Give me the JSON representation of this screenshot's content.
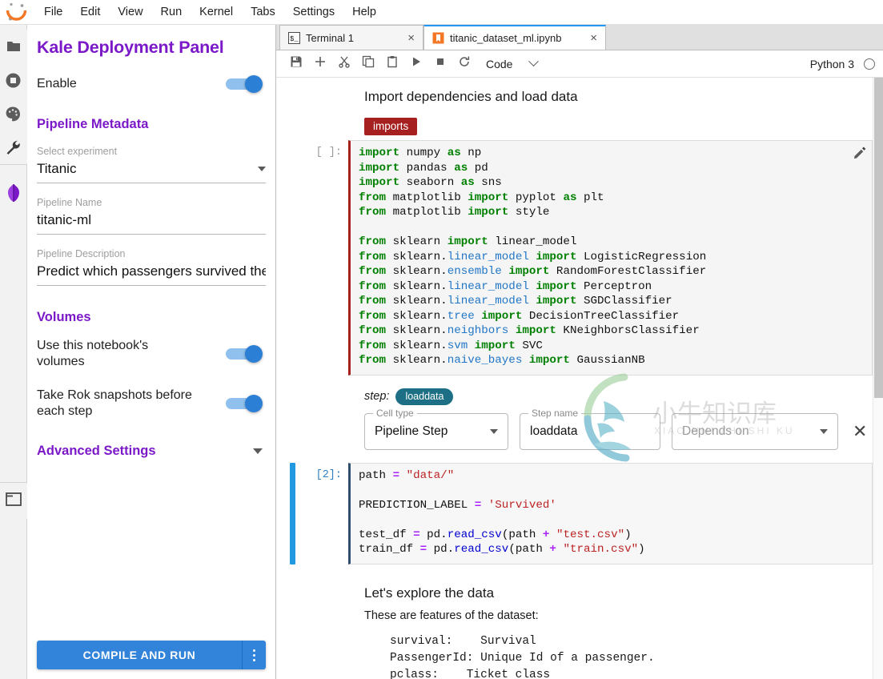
{
  "menubar": {
    "logo_icon": "jupyter-logo-icon",
    "items": [
      "File",
      "Edit",
      "View",
      "Run",
      "Kernel",
      "Tabs",
      "Settings",
      "Help"
    ]
  },
  "rail": {
    "items": [
      {
        "icon": "folder-icon",
        "name": "file-browser"
      },
      {
        "icon": "running-terminals-icon",
        "name": "running-terminals"
      },
      {
        "icon": "palette-icon",
        "name": "command-palette"
      },
      {
        "icon": "wrench-icon",
        "name": "property-inspector"
      },
      {
        "icon": "kale-logo-icon",
        "name": "kale-panel"
      },
      {
        "icon": "window-icon",
        "name": "open-tabs"
      }
    ]
  },
  "kale": {
    "title": "Kale Deployment Panel",
    "enable": {
      "label": "Enable",
      "on": true
    },
    "pipeline_metadata": {
      "section": "Pipeline Metadata",
      "experiment": {
        "label": "Select experiment",
        "value": "Titanic"
      },
      "pipeline_name": {
        "label": "Pipeline Name",
        "value": "titanic-ml"
      },
      "pipeline_description": {
        "label": "Pipeline Description",
        "value": "Predict which passengers survived the"
      }
    },
    "volumes": {
      "section": "Volumes",
      "use_notebook_volumes": {
        "label": "Use this notebook's volumes",
        "on": true
      },
      "rok_snapshots": {
        "label": "Take Rok snapshots before each step",
        "on": true
      }
    },
    "advanced_settings": {
      "label": "Advanced Settings",
      "caret": "chevron-down-icon"
    },
    "compile_and_run": {
      "label": "COMPILE AND RUN",
      "more_icon": "more-vertical-icon"
    },
    "accent_color": "#7b19c9",
    "button_color": "#3284da",
    "toggle_color": "#2b7fd4"
  },
  "dock": {
    "tabs": [
      {
        "label": "Terminal 1",
        "icon": "terminal-icon",
        "active": false,
        "close": "×"
      },
      {
        "label": "titanic_dataset_ml.ipynb",
        "icon": "notebook-icon",
        "active": true,
        "close": "×"
      }
    ]
  },
  "notebook_toolbar": {
    "buttons": [
      {
        "name": "save-button",
        "icon": "save-icon"
      },
      {
        "name": "insert-cell-button",
        "icon": "plus-icon"
      },
      {
        "name": "cut-button",
        "icon": "scissors-icon"
      },
      {
        "name": "copy-button",
        "icon": "copy-icon"
      },
      {
        "name": "paste-button",
        "icon": "clipboard-icon"
      },
      {
        "name": "run-button",
        "icon": "play-icon"
      },
      {
        "name": "interrupt-button",
        "icon": "stop-icon"
      },
      {
        "name": "restart-button",
        "icon": "refresh-icon"
      }
    ],
    "cell_type": "Code",
    "cell_type_caret": "chevron-down-icon",
    "kernel_name": "Python 3",
    "kernel_status_icon": "kernel-idle-circle-icon"
  },
  "notebook": {
    "heading_1": "Import dependencies and load data",
    "cell_tag": "imports",
    "cell_1": {
      "prompt": "[ ]:",
      "edit_icon": "pencil-icon",
      "lines": [
        "import numpy as np",
        "import pandas as pd",
        "import seaborn as sns",
        "from matplotlib import pyplot as plt",
        "from matplotlib import style",
        "",
        "from sklearn import linear_model",
        "from sklearn.linear_model import LogisticRegression",
        "from sklearn.ensemble import RandomForestClassifier",
        "from sklearn.linear_model import Perceptron",
        "from sklearn.linear_model import SGDClassifier",
        "from sklearn.tree import DecisionTreeClassifier",
        "from sklearn.neighbors import KNeighborsClassifier",
        "from sklearn.svm import SVC",
        "from sklearn.naive_bayes import GaussianNB"
      ]
    },
    "step_editor": {
      "step_label": "step:",
      "step_pill": "loaddata",
      "cell_type": {
        "legend": "Cell type",
        "value": "Pipeline Step",
        "caret": "chevron-down-icon"
      },
      "step_name": {
        "legend": "Step name",
        "value": "loaddata"
      },
      "depends_on": {
        "placeholder": "Depends on",
        "value": "",
        "caret": "chevron-down-icon"
      },
      "close_icon": "close-icon"
    },
    "cell_2": {
      "prompt": "[2]:",
      "lines": [
        "path = \"data/\"",
        "",
        "PREDICTION_LABEL = 'Survived'",
        "",
        "test_df = pd.read_csv(path + \"test.csv\")",
        "train_df = pd.read_csv(path + \"train.csv\")"
      ]
    },
    "heading_2": "Let's explore the data",
    "paragraph_2": "These are features of the dataset:",
    "features_pre": "survival:    Survival\nPassengerId: Unique Id of a passenger.\npclass:    Ticket class"
  },
  "watermark": {
    "text": "小牛知识库",
    "subtext": "XIAO NIU ZHI SHI KU"
  }
}
